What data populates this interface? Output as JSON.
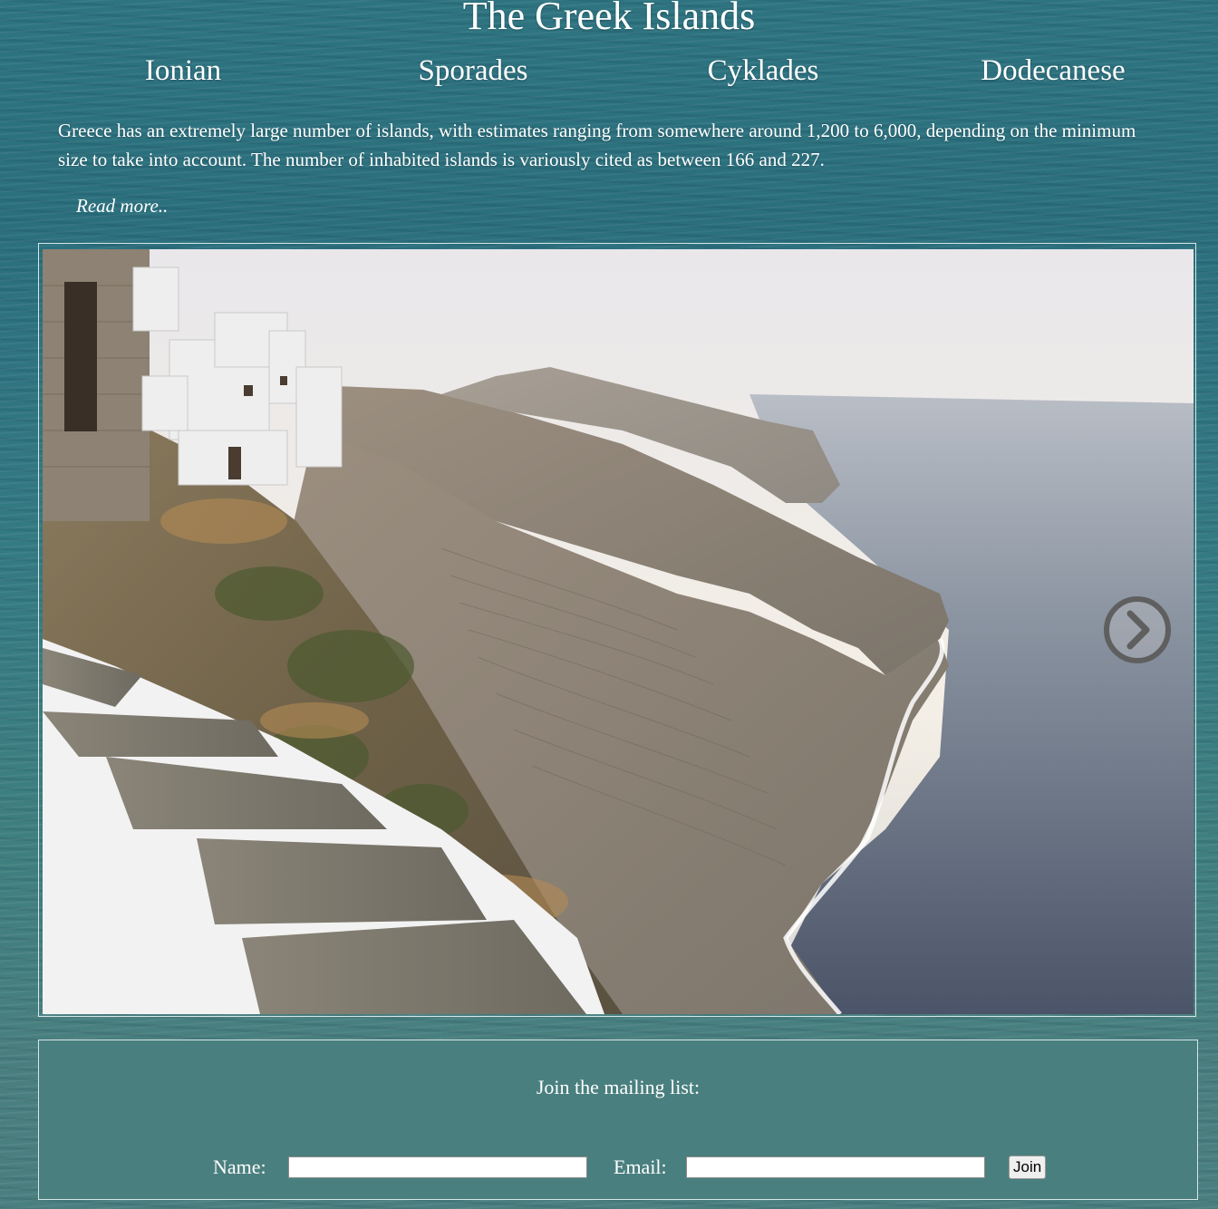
{
  "site": {
    "title": "The Greek Islands"
  },
  "nav": {
    "items": [
      {
        "label": "Ionian"
      },
      {
        "label": "Sporades"
      },
      {
        "label": "Cyklades"
      },
      {
        "label": "Dodecanese"
      }
    ]
  },
  "intro": {
    "text": "Greece has an extremely large number of islands, with estimates ranging from somewhere around 1,200 to 6,000, depending on the minimum size to take into account. The number of inhabited islands is variously cited as between 166 and 227.",
    "read_more": "Read more.."
  },
  "slideshow": {
    "next_icon": "chevron-right-circle-icon"
  },
  "mailing": {
    "heading": "Join the mailing list:",
    "name_label": "Name:",
    "name_value": "",
    "email_label": "Email:",
    "email_value": "",
    "join_label": "Join"
  }
}
